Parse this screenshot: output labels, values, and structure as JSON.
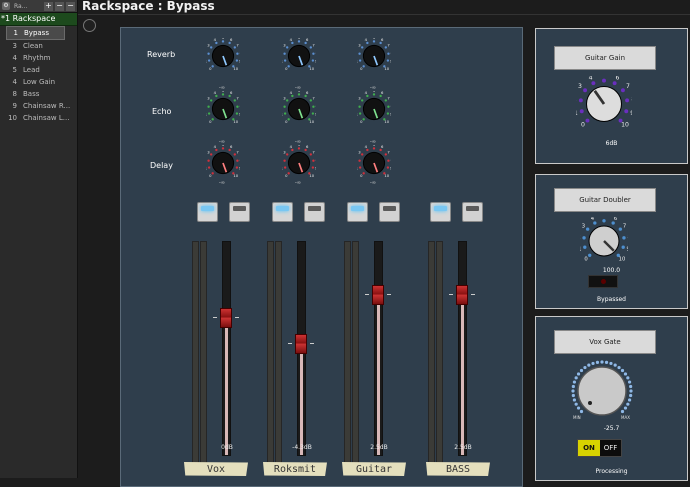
{
  "sidebar": {
    "top_label": "Ra...",
    "rackspace": "*1  Rackspace",
    "variations": [
      {
        "n": "1",
        "label": "Bypass"
      },
      {
        "n": "3",
        "label": "Clean"
      },
      {
        "n": "4",
        "label": "Rhythm"
      },
      {
        "n": "5",
        "label": "Lead"
      },
      {
        "n": "4",
        "label": "Low Gain"
      },
      {
        "n": "8",
        "label": "Bass"
      },
      {
        "n": "9",
        "label": "Chainsaw R..."
      },
      {
        "n": "10",
        "label": "Chainsaw L..."
      }
    ],
    "btn_add": "+",
    "btn_remove": "−",
    "btn_more": "−"
  },
  "header": {
    "title": "Rackspace : Bypass"
  },
  "fx": {
    "reverb": "Reverb",
    "echo": "Echo",
    "delay": "Delay",
    "inf": "-∞",
    "scale": [
      "0",
      "1",
      "2",
      "3",
      "4",
      "5",
      "6",
      "7",
      "8",
      "9",
      "10"
    ]
  },
  "channels": [
    {
      "db": "0dB",
      "name": "Vox",
      "level": 0.64
    },
    {
      "db": "-4.3dB",
      "name": "Roksmit",
      "level": 0.52
    },
    {
      "db": "2.5dB",
      "name": "Guitar",
      "level": 0.75
    },
    {
      "db": "2.5dB",
      "name": "BASS",
      "level": 0.75
    }
  ],
  "guitar_gain": {
    "title": "Guitar Gain",
    "value": "6dB"
  },
  "guitar_doubler": {
    "title": "Guitar Doubler",
    "value": "100.0",
    "status": "Bypassed"
  },
  "vox_gate": {
    "title": "Vox Gate",
    "min": "MIN",
    "max": "MAX",
    "value": "-25.7",
    "on": "ON",
    "off": "OFF",
    "status": "Processing"
  },
  "colors": {
    "reverb": "#5b8fd1",
    "echo": "#3fae4e",
    "delay": "#d0303c",
    "gain": "#6a2fbf",
    "doubler": "#4d8fcf",
    "panel": "#2f3e4c"
  }
}
